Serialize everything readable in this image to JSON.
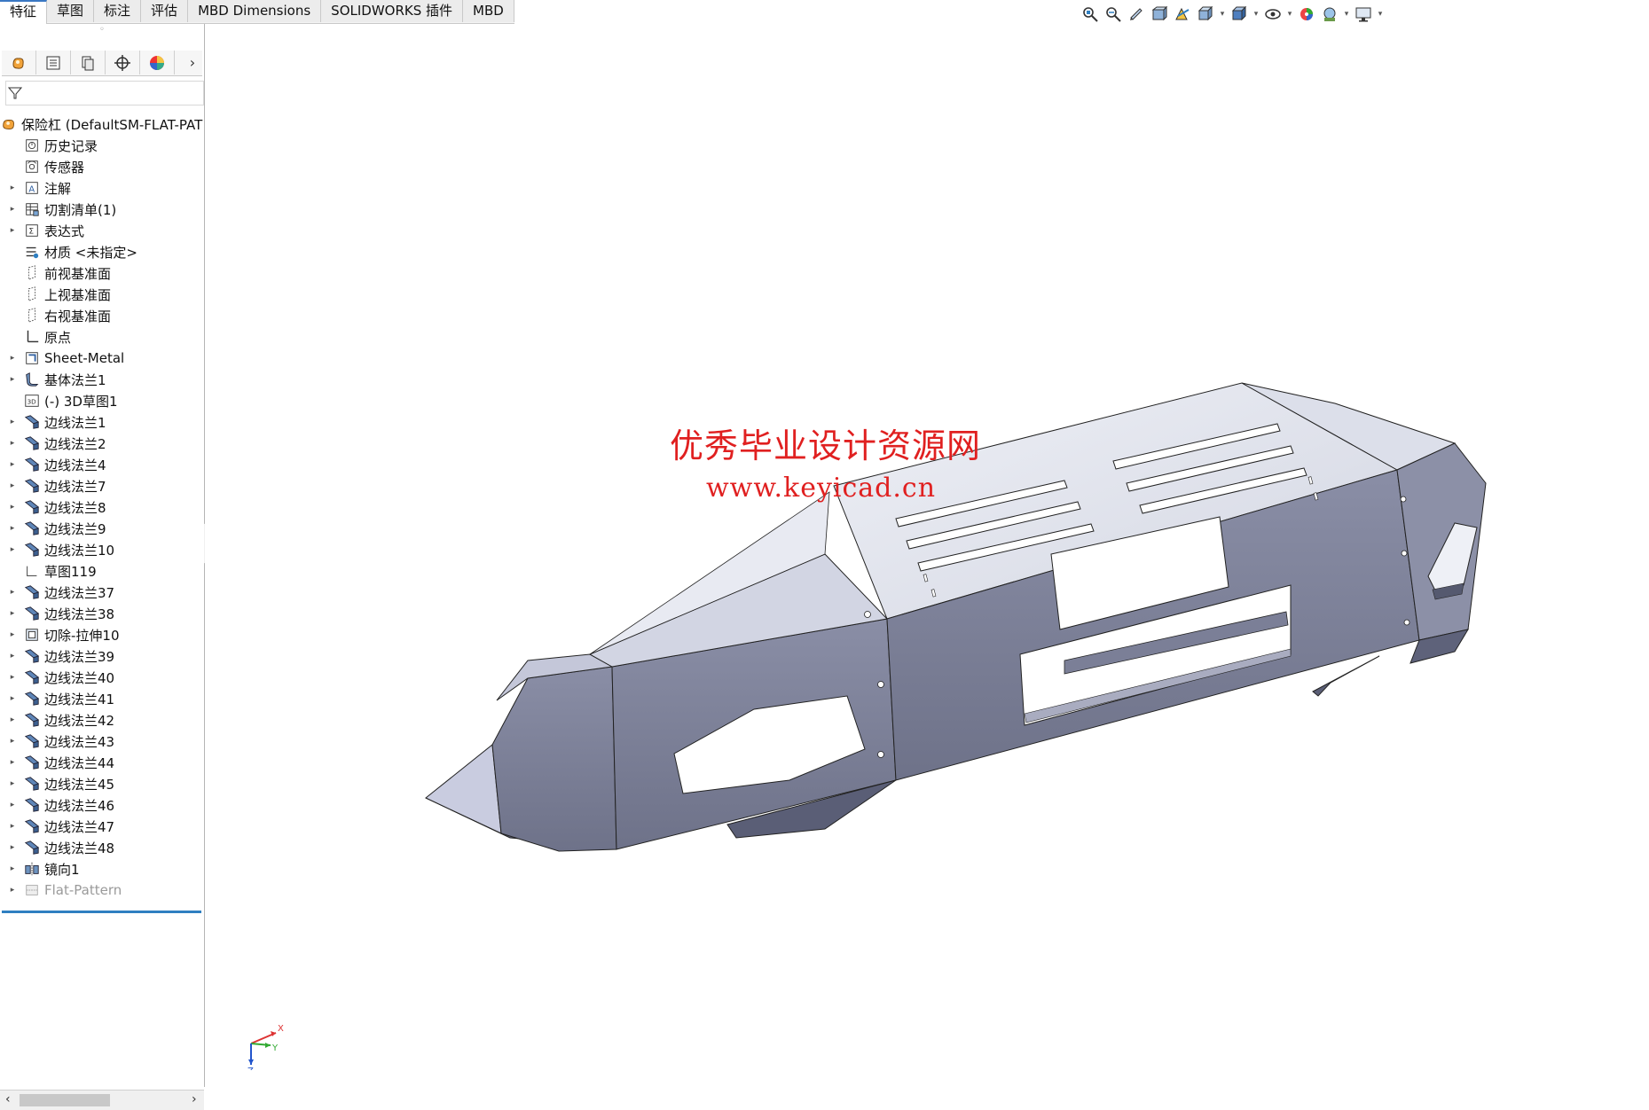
{
  "command_tabs": [
    {
      "label": "特征",
      "active": true
    },
    {
      "label": "草图",
      "active": false
    },
    {
      "label": "标注",
      "active": false
    },
    {
      "label": "评估",
      "active": false
    },
    {
      "label": "MBD Dimensions",
      "active": false
    },
    {
      "label": "SOLIDWORKS 插件",
      "active": false
    },
    {
      "label": "MBD",
      "active": false
    }
  ],
  "hud_icons": [
    "zoom-to-fit-icon",
    "zoom-to-area-icon",
    "previous-view-icon",
    "section-view-icon",
    "dynamic-annotation-icon",
    "view-orientation-icon",
    "display-style-icon",
    "hide-show-items-icon",
    "edit-appearance-icon",
    "apply-scene-icon",
    "view-settings-icon"
  ],
  "panel_tabs": [
    "feature-manager-icon",
    "property-manager-icon",
    "configuration-manager-icon",
    "dimxpert-manager-icon",
    "display-manager-icon"
  ],
  "tree": {
    "root": "保险杠 (DefaultSM-FLAT-PAT",
    "items": [
      {
        "label": "历史记录",
        "icon": "history-icon",
        "expandable": false
      },
      {
        "label": "传感器",
        "icon": "sensor-icon",
        "expandable": false
      },
      {
        "label": "注解",
        "icon": "annotation-icon",
        "expandable": true
      },
      {
        "label": "切割清单(1)",
        "icon": "cut-list-icon",
        "expandable": true
      },
      {
        "label": "表达式",
        "icon": "equation-icon",
        "expandable": true
      },
      {
        "label": "材质 <未指定>",
        "icon": "material-icon",
        "expandable": false
      },
      {
        "label": "前视基准面",
        "icon": "plane-icon",
        "expandable": false
      },
      {
        "label": "上视基准面",
        "icon": "plane-icon",
        "expandable": false
      },
      {
        "label": "右视基准面",
        "icon": "plane-icon",
        "expandable": false
      },
      {
        "label": "原点",
        "icon": "origin-icon",
        "expandable": false
      },
      {
        "label": "Sheet-Metal",
        "icon": "sheet-metal-icon",
        "expandable": true
      },
      {
        "label": "基体法兰1",
        "icon": "base-flange-icon",
        "expandable": true
      },
      {
        "label": "(-) 3D草图1",
        "icon": "sketch-3d-icon",
        "expandable": false
      },
      {
        "label": "边线法兰1",
        "icon": "edge-flange-icon",
        "expandable": true
      },
      {
        "label": "边线法兰2",
        "icon": "edge-flange-icon",
        "expandable": true
      },
      {
        "label": "边线法兰4",
        "icon": "edge-flange-icon",
        "expandable": true
      },
      {
        "label": "边线法兰7",
        "icon": "edge-flange-icon",
        "expandable": true
      },
      {
        "label": "边线法兰8",
        "icon": "edge-flange-icon",
        "expandable": true
      },
      {
        "label": "边线法兰9",
        "icon": "edge-flange-icon",
        "expandable": true
      },
      {
        "label": "边线法兰10",
        "icon": "edge-flange-icon",
        "expandable": true
      },
      {
        "label": "草图119",
        "icon": "sketch-icon",
        "expandable": false
      },
      {
        "label": "边线法兰37",
        "icon": "edge-flange-icon",
        "expandable": true
      },
      {
        "label": "边线法兰38",
        "icon": "edge-flange-icon",
        "expandable": true
      },
      {
        "label": "切除-拉伸10",
        "icon": "cut-extrude-icon",
        "expandable": true
      },
      {
        "label": "边线法兰39",
        "icon": "edge-flange-icon",
        "expandable": true
      },
      {
        "label": "边线法兰40",
        "icon": "edge-flange-icon",
        "expandable": true
      },
      {
        "label": "边线法兰41",
        "icon": "edge-flange-icon",
        "expandable": true
      },
      {
        "label": "边线法兰42",
        "icon": "edge-flange-icon",
        "expandable": true
      },
      {
        "label": "边线法兰43",
        "icon": "edge-flange-icon",
        "expandable": true
      },
      {
        "label": "边线法兰44",
        "icon": "edge-flange-icon",
        "expandable": true
      },
      {
        "label": "边线法兰45",
        "icon": "edge-flange-icon",
        "expandable": true
      },
      {
        "label": "边线法兰46",
        "icon": "edge-flange-icon",
        "expandable": true
      },
      {
        "label": "边线法兰47",
        "icon": "edge-flange-icon",
        "expandable": true
      },
      {
        "label": "边线法兰48",
        "icon": "edge-flange-icon",
        "expandable": true
      },
      {
        "label": "镜向1",
        "icon": "mirror-icon",
        "expandable": true
      },
      {
        "label": "Flat-Pattern",
        "icon": "flat-pattern-icon",
        "expandable": true,
        "disabled": true
      }
    ]
  },
  "watermark": {
    "line1": "优秀毕业设计资源网",
    "line2": "www.keyicad.cn"
  },
  "triad": {
    "x": "X",
    "y": "Y",
    "z": "Z"
  },
  "colors": {
    "accent": "#2f7fc1",
    "model_face": "#7b7f97",
    "model_top": "#e4e6ef",
    "watermark": "#e02020"
  }
}
